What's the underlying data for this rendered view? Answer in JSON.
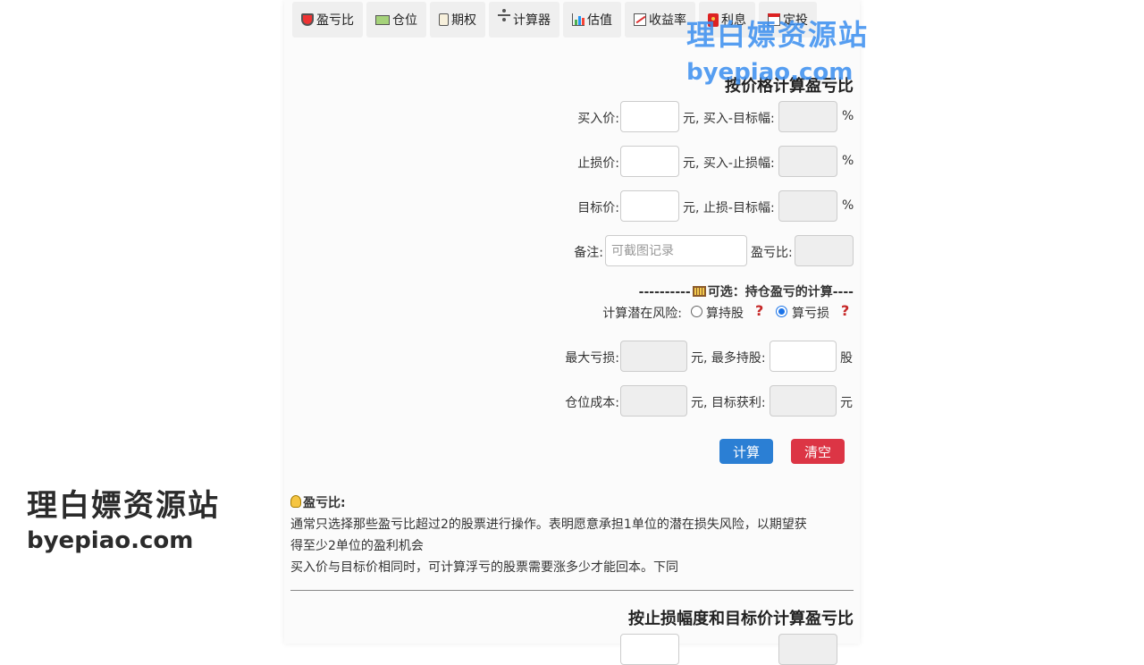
{
  "tabs": [
    {
      "icon": "shield-icon",
      "label": "盈亏比"
    },
    {
      "icon": "money-icon",
      "label": "仓位"
    },
    {
      "icon": "scroll-icon",
      "label": "期权"
    },
    {
      "icon": "divide-icon",
      "label": "计算器"
    },
    {
      "icon": "bar-chart-icon",
      "label": "估值"
    },
    {
      "icon": "trend-chart-icon",
      "label": "收益率"
    },
    {
      "icon": "red-envelope-icon",
      "label": "利息"
    },
    {
      "icon": "calendar-icon",
      "label": "定投"
    }
  ],
  "section1": {
    "title": "按价格计算盈亏比",
    "buy_price_label": "买入价:",
    "buy_target_label": "元, 买入-目标幅:",
    "stop_price_label": "止损价:",
    "buy_stop_label": "元, 买入-止损幅:",
    "target_price_label": "目标价:",
    "stop_target_label": "元, 止损-目标幅:",
    "percent": "%",
    "note_label": "备注:",
    "note_placeholder": "可截图记录",
    "ratio_label": "盈亏比:"
  },
  "optional": {
    "header_prefix": "----------",
    "header_text": "可选：持仓盈亏的计算----",
    "risk_label": "计算潜在风险:",
    "option_shares": "算持股",
    "option_loss": "算亏损",
    "help": "?",
    "max_loss_label": "最大亏损:",
    "max_shares_label": "元, 最多持股:",
    "shares_unit": "股",
    "position_cost_label": "仓位成本:",
    "target_profit_label": "元, 目标获利:",
    "yuan": "元"
  },
  "buttons": {
    "calc": "计算",
    "clear": "清空"
  },
  "notes": {
    "heading": "盈亏比:",
    "line1": "通常只选择那些盈亏比超过2的股票进行操作。表明愿意承担1单位的潜在损失风险，以期望获",
    "line2": "得至少2单位的盈利机会",
    "line3": "买入价与目标价相同时，可计算浮亏的股票需要涨多少才能回本。下同"
  },
  "section2": {
    "title": "按止损幅度和目标价计算盈亏比"
  },
  "watermark": {
    "cn": "理白嫖资源站",
    "en": "byepiao.com"
  }
}
